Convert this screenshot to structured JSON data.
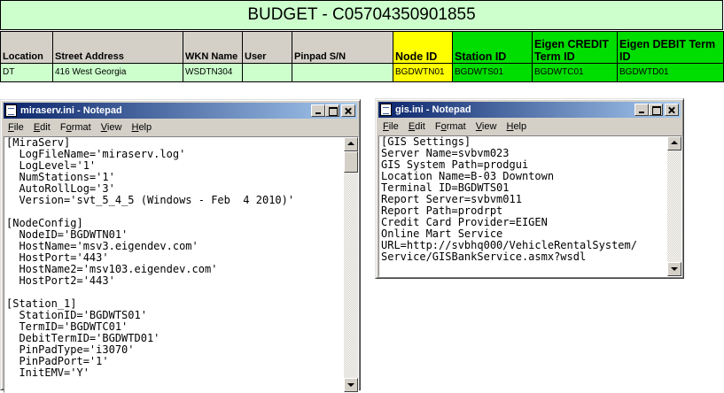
{
  "sheet": {
    "title": "BUDGET - C05704350901855",
    "headers": [
      "Location",
      "Street Address",
      "WKN Name",
      "User",
      "Pinpad S/N",
      "Node ID",
      "Station ID",
      "Eigen CREDIT Term ID",
      "Eigen DEBIT Term ID"
    ],
    "row": [
      "DT",
      "416 West Georgia",
      "WSDTN304",
      "",
      "",
      "BGDWTN01",
      "BGDWTS01",
      "BGDWTC01",
      "BGDWTD01"
    ],
    "colors": {
      "title_bg": "#ccffcc",
      "header_bg": "#d4d0c8",
      "node_id": "#ffff00",
      "eigen_ids": "#00dd00"
    }
  },
  "menu": {
    "file": {
      "acc": "F",
      "rest": "ile"
    },
    "edit": {
      "acc": "E",
      "rest": "dit"
    },
    "format": {
      "pre": "F",
      "acc": "o",
      "rest": "rmat"
    },
    "view": {
      "acc": "V",
      "rest": "iew"
    },
    "help": {
      "acc": "H",
      "rest": "elp"
    }
  },
  "notepad_left": {
    "title": "miraserv.ini - Notepad",
    "lines": [
      "[MiraServ]",
      "  LogFileName='miraserv.log'",
      "  LogLevel='1'",
      "  NumStations='1'",
      "  AutoRollLog='3'",
      "  Version='svt_5_4_5 (Windows - Feb  4 2010)'",
      "",
      "[NodeConfig]",
      "  NodeID='BGDWTN01'",
      "  HostName='msv3.eigendev.com'",
      "  HostPort='443'",
      "  HostName2='msv103.eigendev.com'",
      "  HostPort2='443'",
      "",
      "[Station_1]",
      "  StationID='BGDWTS01'",
      "  TermID='BGDWTC01'",
      "  DebitTermID='BGDWTD01'",
      "  PinPadType='i3070'",
      "  PinPadPort='1'",
      "  InitEMV='Y'"
    ]
  },
  "notepad_right": {
    "title": "gis.ini - Notepad",
    "lines": [
      "[GIS Settings]",
      "Server Name=svbvm023",
      "GIS System Path=prodgui",
      "Location Name=B-03 Downtown",
      "Terminal ID=BGDWTS01",
      "Report Server=svbvm011",
      "Report Path=prodrpt",
      "Credit Card Provider=EIGEN",
      "Online Mart Service",
      "URL=http://svbhq000/VehicleRentalSystem/",
      "Service/GISBankService.asmx?wsdl"
    ]
  },
  "icons": [
    "notepad-icon",
    "minimize-icon",
    "maximize-icon",
    "close-icon",
    "scroll-up-icon",
    "scroll-down-icon"
  ]
}
